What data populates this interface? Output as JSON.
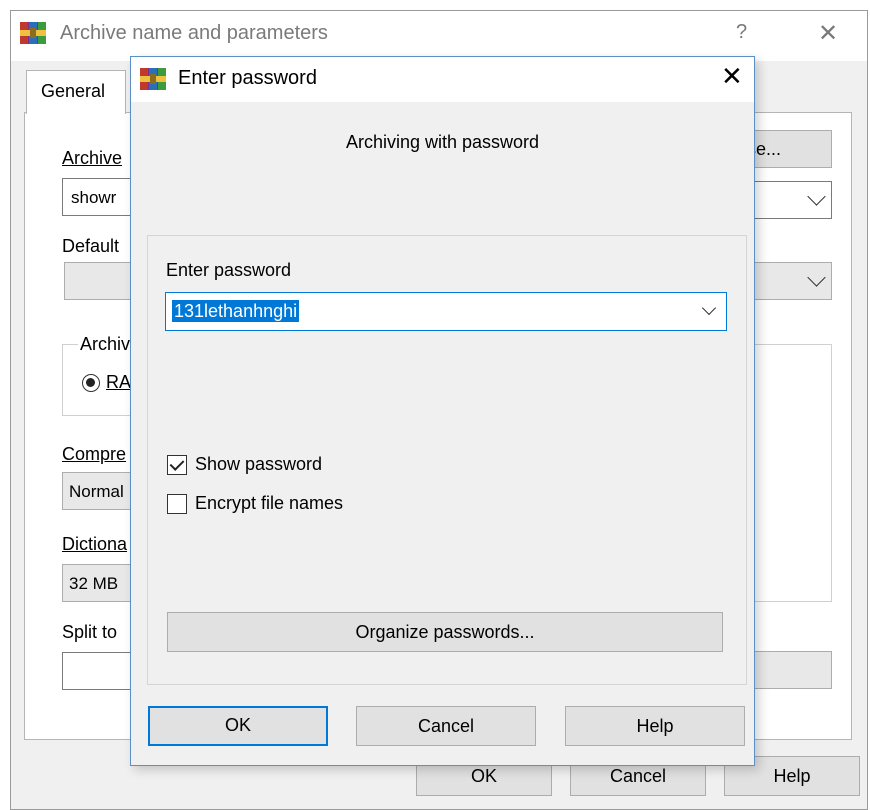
{
  "background_window": {
    "title": "Archive name and parameters",
    "help_glyph": "?",
    "close_glyph": "✕",
    "tab_general": "General",
    "archive_name_label": "Archive",
    "archive_name_value": "showr",
    "browse_label": "se...",
    "default_profile_label": "Default",
    "archive_format_group": "Archiv",
    "format_rar": "RA",
    "compression_label": "Compre",
    "compression_value": "Normal",
    "dictionary_label": "Dictiona",
    "dictionary_value": "32 MB",
    "split_label": "Split to",
    "ok_label": "OK",
    "cancel_label": "Cancel",
    "help_label": "Help"
  },
  "dialog": {
    "title": "Enter password",
    "close_glyph": "✕",
    "subtitle": "Archiving with password",
    "password_label": "Enter password",
    "password_value": "131lethanhnghi",
    "show_password_label": "Show password",
    "show_password_checked": true,
    "encrypt_names_label": "Encrypt file names",
    "encrypt_names_checked": false,
    "organize_label": "Organize passwords...",
    "ok_label": "OK",
    "cancel_label": "Cancel",
    "help_label": "Help"
  },
  "icons": {
    "app": "winrar-icon",
    "dropdown": "chevron-down-icon",
    "check": "check-icon"
  },
  "colors": {
    "accent": "#0078d7",
    "dialog_bg": "#f0f0f0",
    "button_bg": "#e1e1e1"
  }
}
